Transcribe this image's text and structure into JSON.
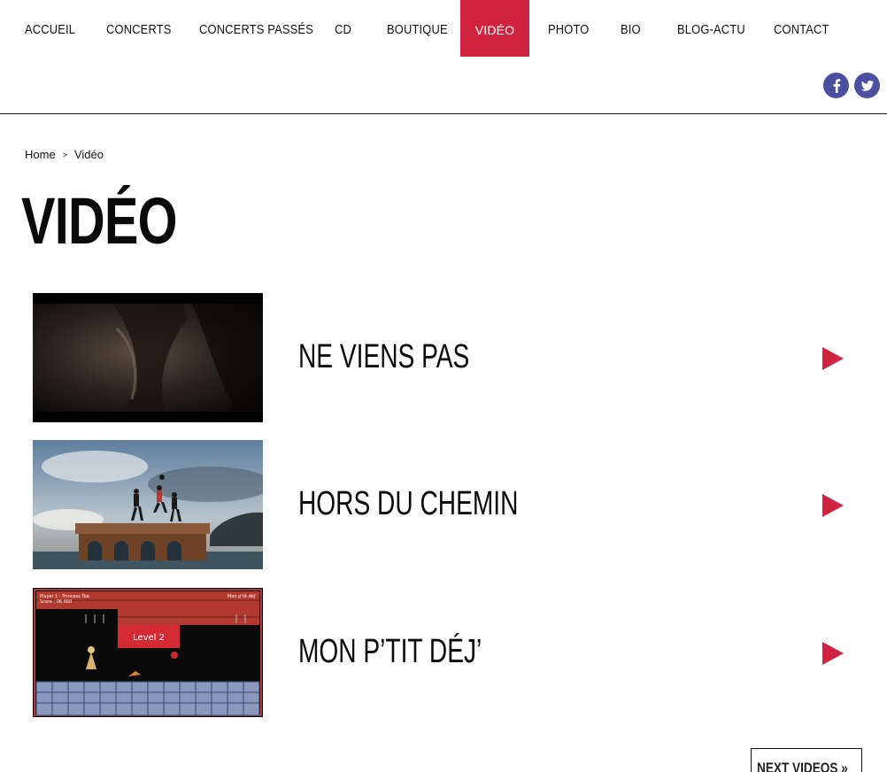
{
  "nav": {
    "items": [
      {
        "label": "ACCUEIL"
      },
      {
        "label": "CONCERTS"
      },
      {
        "label": "CONCERTS PASSÉS"
      },
      {
        "label": "CD"
      },
      {
        "label": "BOUTIQUE"
      },
      {
        "label": "VIDÉO",
        "active": true
      },
      {
        "label": "PHOTO"
      },
      {
        "label": "BIO"
      },
      {
        "label": "BLOG-ACTU"
      },
      {
        "label": "CONTACT"
      }
    ]
  },
  "social": {
    "icons": [
      "facebook-icon",
      "twitter-icon"
    ],
    "color": "#4b4fa0"
  },
  "breadcrumb": {
    "home": "Home",
    "separator": ">",
    "current": "Vidéo"
  },
  "page": {
    "title": "VIDÉO"
  },
  "videos": [
    {
      "title": "NE VIENS PAS"
    },
    {
      "title": "HORS DU CHEMIN"
    },
    {
      "title": "MON P’TIT DÉJ’",
      "thumb_text": {
        "player": "Player 1 : Princess Tea",
        "score": "Score : 06 660",
        "game_title": "Mon p'tit déj'",
        "level": "Level 2"
      }
    }
  ],
  "pagination": {
    "next_label": "NEXT VIDEOS »"
  },
  "colors": {
    "accent": "#cf2340",
    "text": "#111111",
    "background": "#ffffff"
  }
}
